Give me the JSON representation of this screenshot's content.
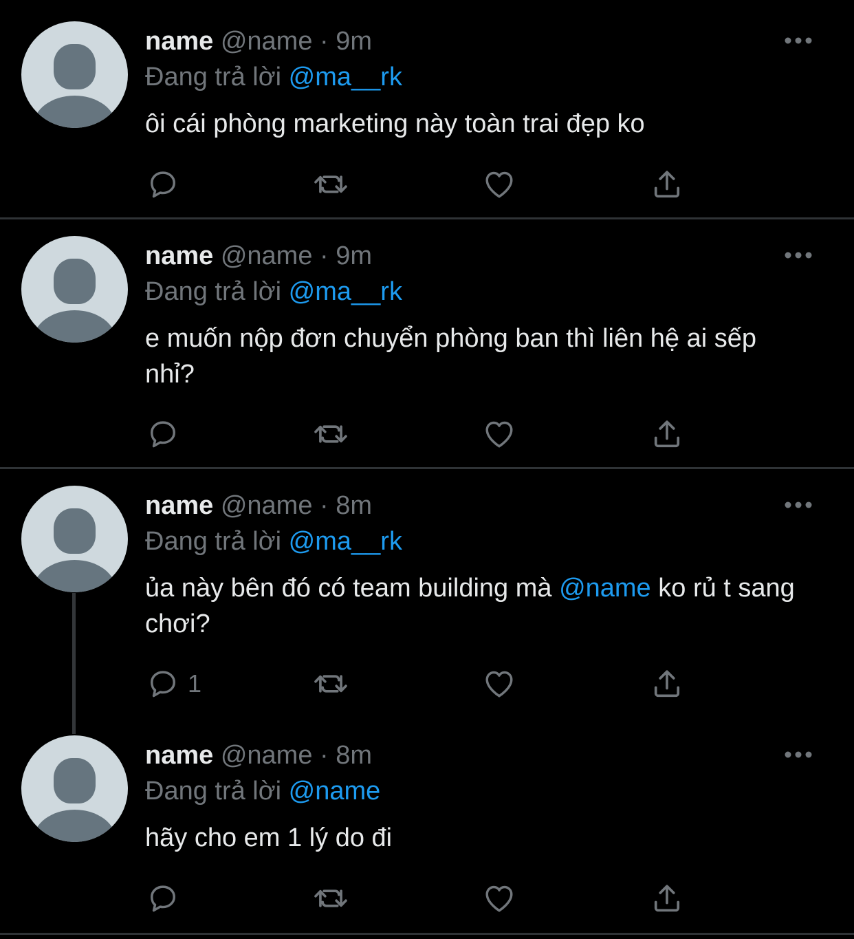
{
  "colors": {
    "background": "#000000",
    "text": "#e7e9ea",
    "secondary": "#71767b",
    "accent": "#1d9bf0",
    "divider": "#2f3336"
  },
  "tweets": [
    {
      "name": "name",
      "handle": "@name",
      "dot": "·",
      "time": "9m",
      "reply_prefix": "Đang trả lời",
      "reply_to": "@ma__rk",
      "text_before": "ôi cái phòng marketing này toàn trai đẹp ko",
      "text_mention": "",
      "text_after": "",
      "reply_count": ""
    },
    {
      "name": "name",
      "handle": "@name",
      "dot": "·",
      "time": "9m",
      "reply_prefix": "Đang trả lời",
      "reply_to": "@ma__rk",
      "text_before": "e muốn nộp đơn chuyển phòng ban thì liên hệ ai sếp nhỉ?",
      "text_mention": "",
      "text_after": "",
      "reply_count": ""
    },
    {
      "name": "name",
      "handle": "@name",
      "dot": "·",
      "time": "8m",
      "reply_prefix": "Đang trả lời",
      "reply_to": "@ma__rk",
      "text_before": "ủa này bên đó có team building mà ",
      "text_mention": "@name",
      "text_after": " ko rủ t sang chơi?",
      "reply_count": "1"
    },
    {
      "name": "name",
      "handle": "@name",
      "dot": "·",
      "time": "8m",
      "reply_prefix": "Đang trả lời",
      "reply_to": "@name",
      "text_before": "hãy cho em 1 lý do đi",
      "text_mention": "",
      "text_after": "",
      "reply_count": ""
    }
  ],
  "icons": {
    "reply": "reply-icon",
    "retweet": "retweet-icon",
    "like": "heart-icon",
    "share": "share-icon",
    "more": "more-icon"
  }
}
